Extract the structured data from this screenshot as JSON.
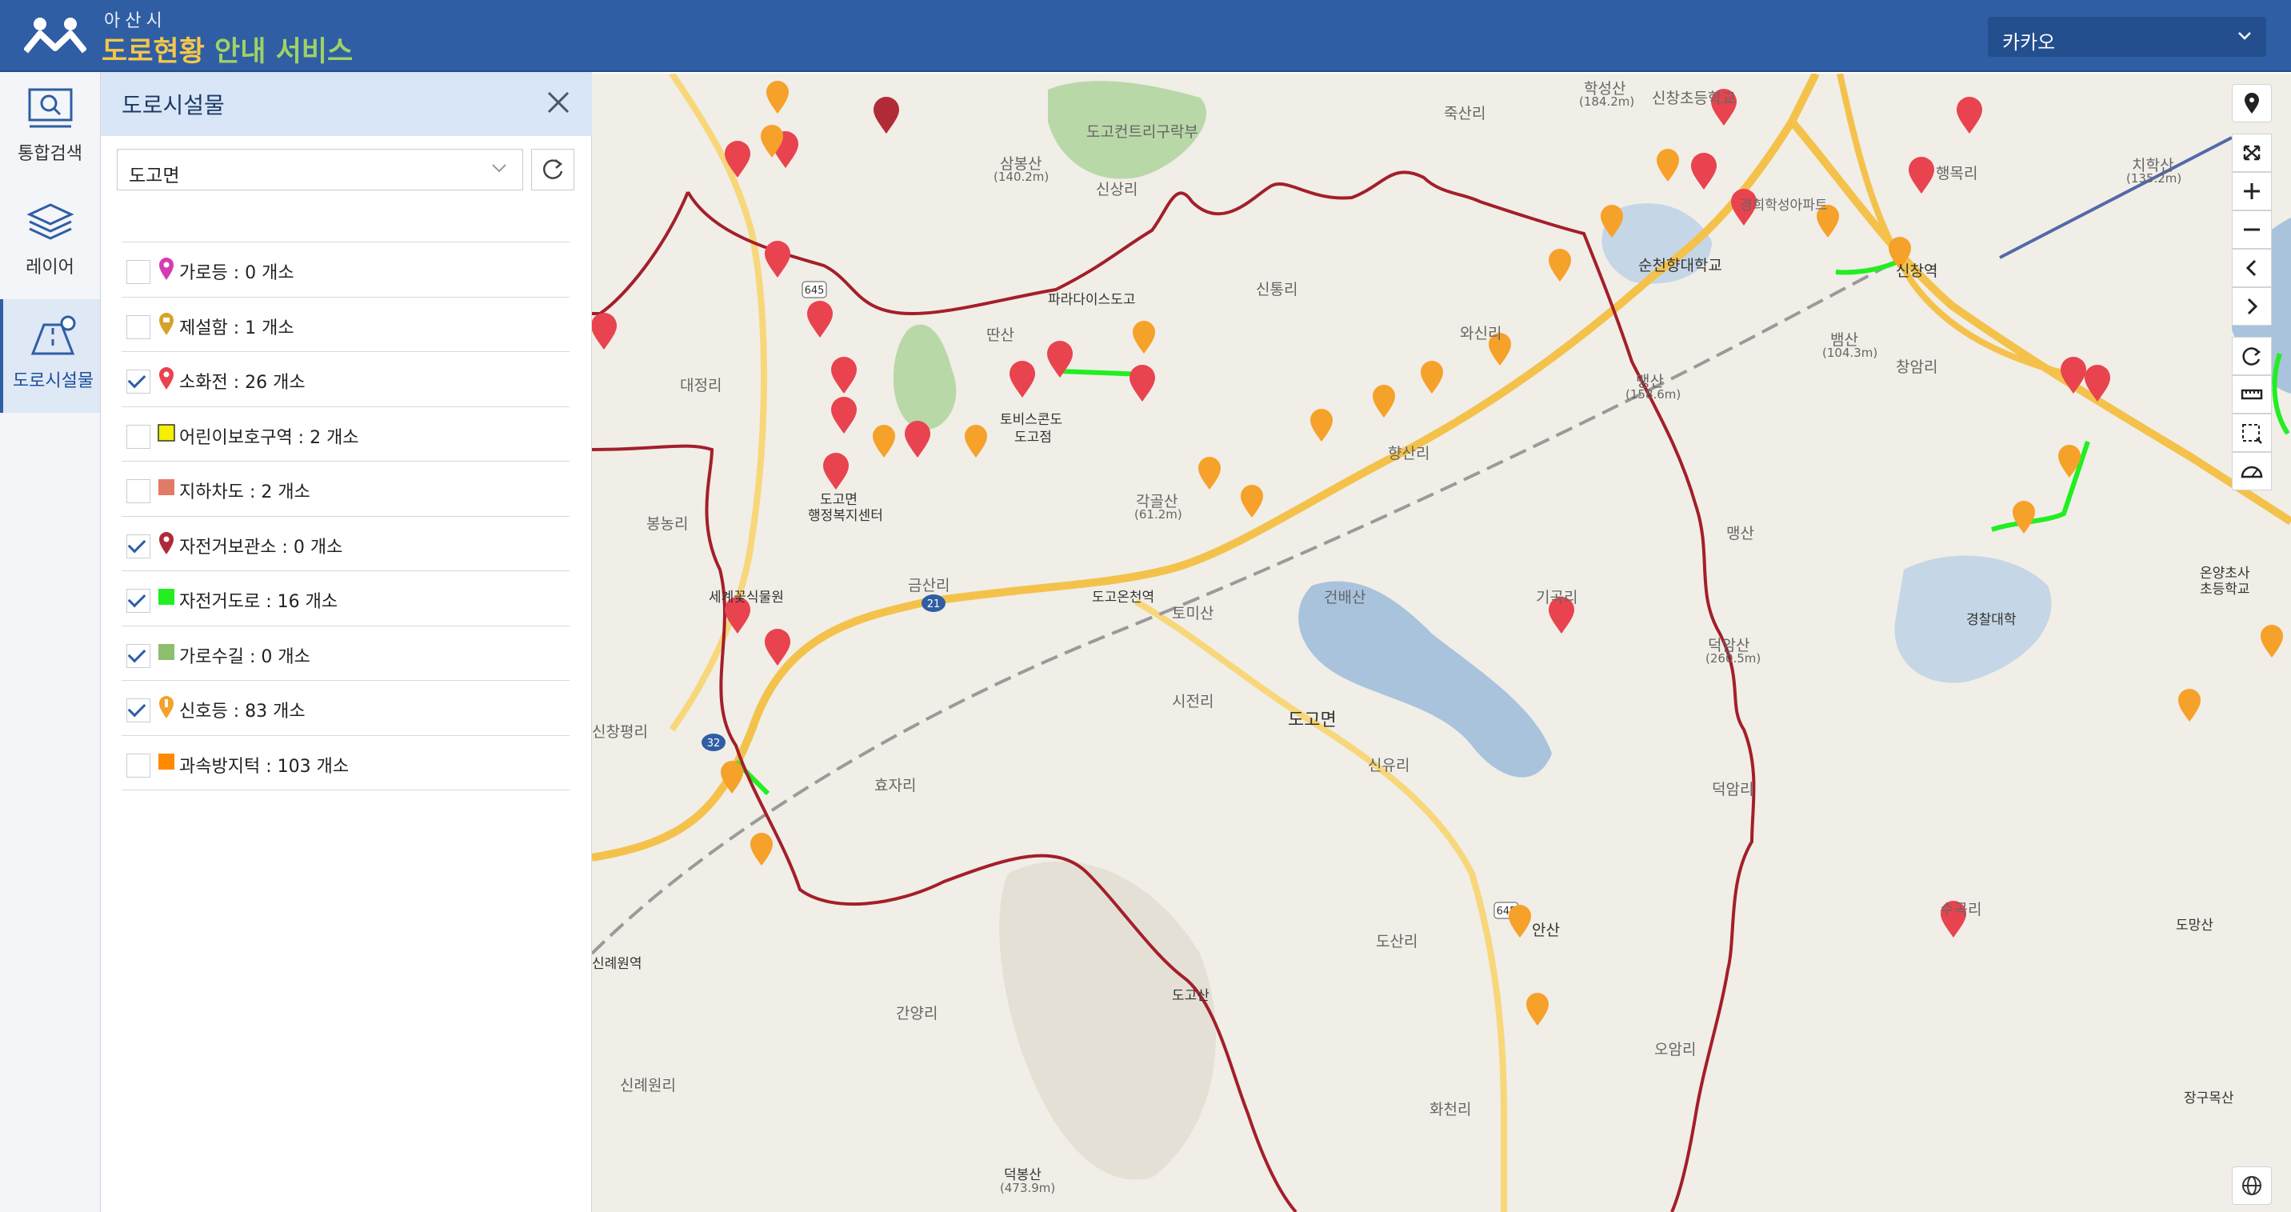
{
  "header": {
    "city": "아산시",
    "title_a": "도로현황",
    "title_b": "안내 서비스",
    "map_select": "카카오"
  },
  "nav": [
    {
      "label": "통합검색",
      "icon": "search-monitor-icon"
    },
    {
      "label": "레이어",
      "icon": "layers-icon"
    },
    {
      "label": "도로시설물",
      "icon": "road-facility-icon",
      "active": true
    }
  ],
  "panel": {
    "title": "도로시설물",
    "dong_select": "도고면",
    "items": [
      {
        "label": "가로등 : 0 개소",
        "checked": false,
        "icon": "streetlight-pin-icon",
        "color": "#d63bb5"
      },
      {
        "label": "제설함 : 1 개소",
        "checked": false,
        "icon": "snowbox-pin-icon",
        "color": "#d8a12a"
      },
      {
        "label": "소화전 : 26 개소",
        "checked": true,
        "icon": "hydrant-pin-icon",
        "color": "#e8434f"
      },
      {
        "label": "어린이보호구역 : 2 개소",
        "checked": false,
        "icon": "yellow-square-icon",
        "color": "#f4f000"
      },
      {
        "label": "지하차도 : 2 개소",
        "checked": false,
        "icon": "salmon-square-icon",
        "color": "#e27a68"
      },
      {
        "label": "자전거보관소 : 0 개소",
        "checked": true,
        "icon": "bike-storage-pin-icon",
        "color": "#b02a37"
      },
      {
        "label": "자전거도로 : 16 개소",
        "checked": true,
        "icon": "green-square-icon",
        "color": "#22ee22"
      },
      {
        "label": "가로수길 : 0 개소",
        "checked": true,
        "icon": "olive-square-icon",
        "color": "#8cbf6e"
      },
      {
        "label": "신호등 : 83 개소",
        "checked": true,
        "icon": "signal-pin-icon",
        "color": "#f6a12a"
      },
      {
        "label": "과속방지턱 : 103 개소",
        "checked": false,
        "icon": "orange-square-icon",
        "color": "#ff8a00"
      }
    ]
  },
  "map": {
    "place_labels": [
      {
        "text": "학성산",
        "sub": "(184.2m)"
      },
      {
        "text": "신창초등학교"
      },
      {
        "text": "도고컨트리구락부"
      },
      {
        "text": "삼봉산",
        "sub": "(140.2m)"
      },
      {
        "text": "신상리"
      },
      {
        "text": "죽산리"
      },
      {
        "text": "행목리"
      },
      {
        "text": "치학산",
        "sub": "(135.2m)"
      },
      {
        "text": "경희학성아파트"
      },
      {
        "text": "순천향대학교"
      },
      {
        "text": "신창역"
      },
      {
        "text": "신통리"
      },
      {
        "text": "딴산"
      },
      {
        "text": "파라다이스도고"
      },
      {
        "text": "대정리"
      },
      {
        "text": "와신리"
      },
      {
        "text": "뱀산",
        "sub": "(104.3m)"
      },
      {
        "text": "창암리"
      },
      {
        "text": "맹산",
        "sub": "(158.6m)"
      },
      {
        "text": "토비스콘도",
        "sub": "도고점"
      },
      {
        "text": "도고면",
        "sub": "행정복지센터"
      },
      {
        "text": "각골산",
        "sub": "(61.2m)"
      },
      {
        "text": "향산리"
      },
      {
        "text": "봉농리"
      },
      {
        "text": "도고온천역"
      },
      {
        "text": "토미산"
      },
      {
        "text": "건배산"
      },
      {
        "text": "금산리"
      },
      {
        "text": "세계꽃식물원"
      },
      {
        "text": "맹산"
      },
      {
        "text": "덕암산",
        "sub": "(260.5m)"
      },
      {
        "text": "온양초사",
        "sub": "초등학교"
      },
      {
        "text": "경찰대학"
      },
      {
        "text": "시전리"
      },
      {
        "text": "도고면"
      },
      {
        "text": "신유리"
      },
      {
        "text": "기곡리"
      },
      {
        "text": "효자리"
      },
      {
        "text": "덕암리"
      },
      {
        "text": "신창평리"
      },
      {
        "text": "안산"
      },
      {
        "text": "도산리"
      },
      {
        "text": "도망산"
      },
      {
        "text": "수곡리"
      },
      {
        "text": "간양리"
      },
      {
        "text": "오암리"
      },
      {
        "text": "도고산"
      },
      {
        "text": "신례원리"
      },
      {
        "text": "화천리"
      },
      {
        "text": "덕봉산",
        "sub": "(473.9m)"
      },
      {
        "text": "장구목산"
      },
      {
        "text": "신례원역"
      }
    ],
    "route_numbers": [
      "645",
      "21",
      "32",
      "645"
    ]
  }
}
